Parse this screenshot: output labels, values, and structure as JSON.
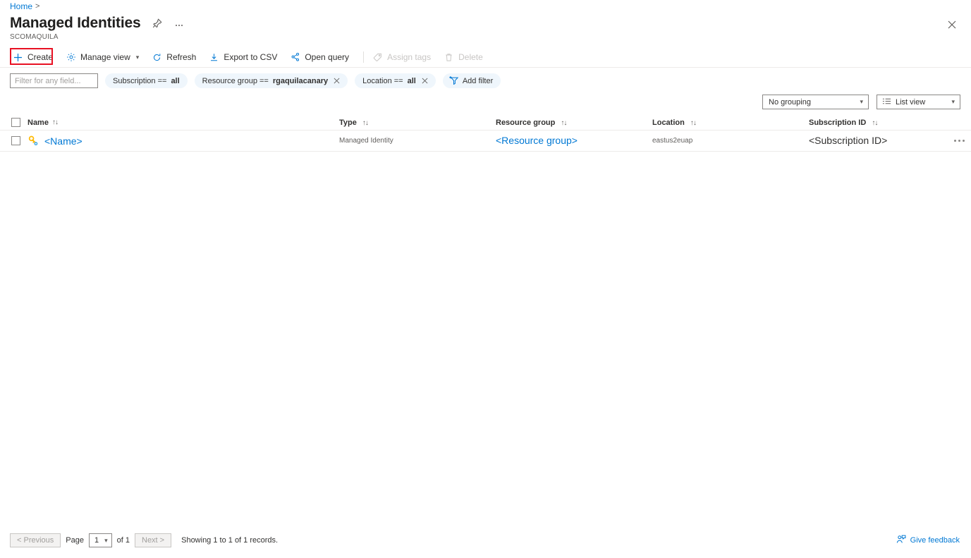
{
  "breadcrumb": {
    "home": "Home",
    "separator": ">"
  },
  "header": {
    "title": "Managed Identities",
    "subtitle": "SCOMAQUILA",
    "pin_icon": "pin-icon",
    "more_icon": "ellipsis-icon",
    "close_icon": "close-icon"
  },
  "toolbar": {
    "create": "Create",
    "manage_view": "Manage view",
    "refresh": "Refresh",
    "export_csv": "Export to CSV",
    "open_query": "Open query",
    "assign_tags": "Assign tags",
    "delete": "Delete",
    "highlight_color": "#e81123"
  },
  "filters": {
    "search_placeholder": "Filter for any field...",
    "search_value": "",
    "pills": [
      {
        "prefix": "Subscription == ",
        "value": "all",
        "removable": false
      },
      {
        "prefix": "Resource group == ",
        "value": "rgaquilacanary",
        "removable": true
      },
      {
        "prefix": "Location == ",
        "value": "all",
        "removable": true
      }
    ],
    "add_filter": "Add filter"
  },
  "view_controls": {
    "grouping": "No grouping",
    "view": "List view"
  },
  "table": {
    "columns": [
      {
        "label": "Name",
        "sortable": true
      },
      {
        "label": "Type",
        "sortable": true
      },
      {
        "label": "Resource group",
        "sortable": true
      },
      {
        "label": "Location",
        "sortable": true
      },
      {
        "label": "Subscription ID",
        "sortable": true
      }
    ],
    "rows": [
      {
        "name": "<Name>",
        "type": "Managed Identity",
        "resource_group": "<Resource group>",
        "location": "eastus2euap",
        "subscription_id": "<Subscription ID>"
      }
    ]
  },
  "footer": {
    "previous": "< Previous",
    "page_label": "Page",
    "page_value": "1",
    "of_label": "of 1",
    "next": "Next >",
    "status": "Showing 1 to 1 of 1 records.",
    "feedback": "Give feedback"
  },
  "colors": {
    "accent": "#0078d4",
    "pill_bg": "#eff6fc",
    "highlight": "#e81123",
    "identity_key": "#ffb900"
  }
}
